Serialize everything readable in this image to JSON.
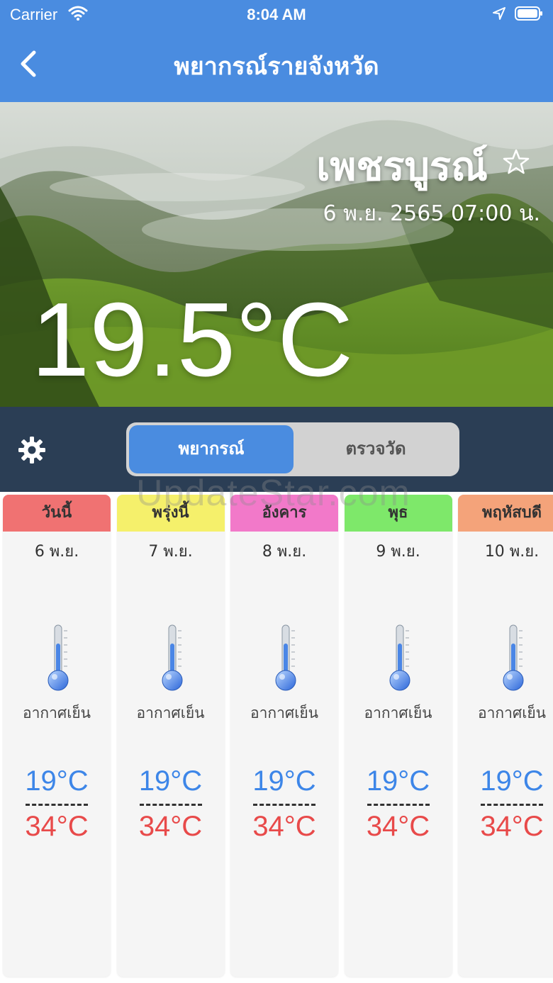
{
  "status_bar": {
    "carrier": "Carrier",
    "time": "8:04 AM"
  },
  "nav": {
    "title": "พยากรณ์รายจังหวัด"
  },
  "hero": {
    "province": "เพชรบูรณ์",
    "datetime": "6 พ.ย. 2565 07:00 น.",
    "current_temp": "19.5°C"
  },
  "segmented": {
    "forecast_label": "พยากรณ์",
    "measure_label": "ตรวจวัด",
    "selected": "forecast"
  },
  "watermark": "UpdateStar.com",
  "days": [
    {
      "day": "วันนี้",
      "date": "6 พ.ย.",
      "condition": "อากาศเย็น",
      "low": "19°C",
      "divider": "------",
      "high": "34°C",
      "color": "#f07272"
    },
    {
      "day": "พรุ่งนี้",
      "date": "7 พ.ย.",
      "condition": "อากาศเย็น",
      "low": "19°C",
      "divider": "------",
      "high": "34°C",
      "color": "#f5f06b"
    },
    {
      "day": "อังคาร",
      "date": "8 พ.ย.",
      "condition": "อากาศเย็น",
      "low": "19°C",
      "divider": "------",
      "high": "34°C",
      "color": "#f279c9"
    },
    {
      "day": "พุธ",
      "date": "9 พ.ย.",
      "condition": "อากาศเย็น",
      "low": "19°C",
      "divider": "------",
      "high": "34°C",
      "color": "#7ee86a"
    },
    {
      "day": "พฤหัสบดี",
      "date": "10 พ.ย.",
      "condition": "อากาศเย็น",
      "low": "19°C",
      "divider": "------",
      "high": "34°C",
      "color": "#f4a37a"
    }
  ]
}
